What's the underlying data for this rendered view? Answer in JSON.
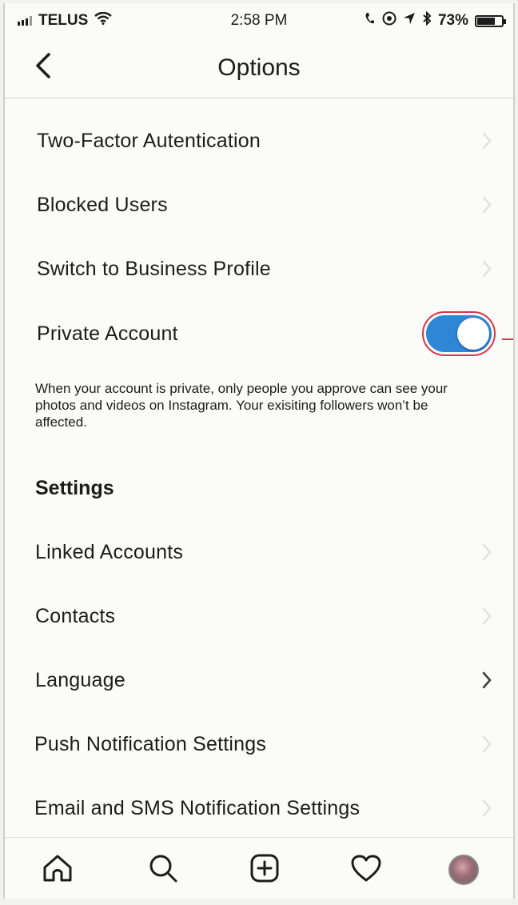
{
  "status_bar": {
    "carrier": "TELUS",
    "time": "2:58 PM",
    "battery_percent": "73%",
    "battery_level": 0.73,
    "icons": [
      "signal-icon",
      "wifi-icon",
      "phone-icon",
      "at-icon",
      "location-icon",
      "bluetooth-icon",
      "battery-icon"
    ]
  },
  "nav": {
    "title": "Options",
    "back_icon": "chevron-left-icon"
  },
  "rows": [
    {
      "label": "Two-Factor Autentication",
      "chevron": "faint"
    },
    {
      "label": "Blocked Users",
      "chevron": "faint"
    },
    {
      "label": "Switch to Business Profile",
      "chevron": "faint"
    }
  ],
  "private_account": {
    "label": "Private Account",
    "enabled": true,
    "toggle_color": "#2d86d6",
    "annotation_color": "#d9344a",
    "helper_text": "When your account is private, only people you approve can see your photos and videos on Instagram. Your exisiting followers won’t be affected."
  },
  "settings_section": {
    "header": "Settings",
    "rows": [
      {
        "label": "Linked Accounts",
        "chevron": "faint"
      },
      {
        "label": "Contacts",
        "chevron": "faint"
      },
      {
        "label": "Language",
        "chevron": "dark"
      },
      {
        "label": "Push Notification Settings",
        "chevron": "faint"
      },
      {
        "label": "Email and SMS Notification Settings",
        "chevron": "faint"
      }
    ]
  },
  "tab_bar": {
    "tabs": [
      "home-icon",
      "search-icon",
      "add-post-icon",
      "activity-heart-icon",
      "profile-avatar"
    ]
  }
}
